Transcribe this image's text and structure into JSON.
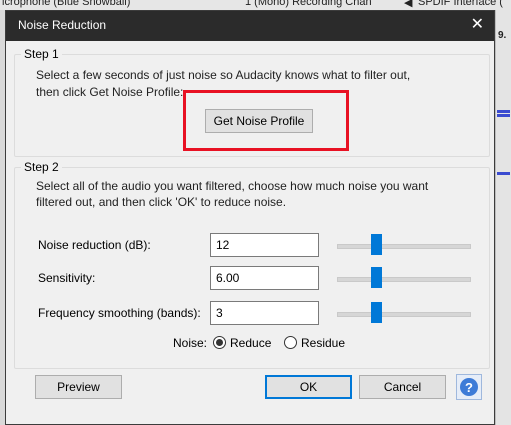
{
  "background": {
    "input_device": "icrophone (Blue Snowball)",
    "channels": "1 (Mono) Recording Chan",
    "output_device": "SPDIF Interface (",
    "ruler_tick": "9."
  },
  "dialog": {
    "title": "Noise Reduction",
    "close_glyph": "✕"
  },
  "step1": {
    "title": "Step 1",
    "description_line1": "Select a few seconds of just noise so Audacity knows what to filter out,",
    "description_line2": "then click Get Noise Profile:",
    "button_label": "Get Noise Profile"
  },
  "step2": {
    "title": "Step 2",
    "description_line1": "Select all of the audio you want filtered, choose how much noise you want",
    "description_line2": "filtered out, and then click 'OK' to reduce noise.",
    "rows": [
      {
        "label": "Noise reduction (dB):",
        "value": "12",
        "slider_fraction": 0.28
      },
      {
        "label": "Sensitivity:",
        "value": "6.00",
        "slider_fraction": 0.28
      },
      {
        "label": "Frequency smoothing (bands):",
        "value": "3",
        "slider_fraction": 0.28
      }
    ],
    "noise_label": "Noise:",
    "noise_options": [
      {
        "label": "Reduce",
        "selected": true
      },
      {
        "label": "Residue",
        "selected": false
      }
    ]
  },
  "footer": {
    "preview_label": "Preview",
    "ok_label": "OK",
    "cancel_label": "Cancel",
    "help_glyph": "?"
  },
  "colors": {
    "accent": "#0078d7",
    "highlight_box": "#e81123",
    "titlebar": "#2b2b2b"
  }
}
